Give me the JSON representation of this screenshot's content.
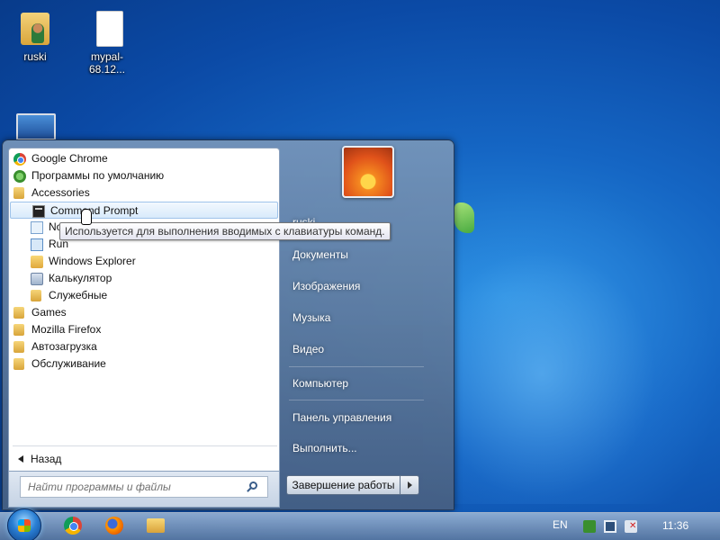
{
  "desktop": {
    "icons": [
      {
        "label": "ruski",
        "icon": "user-folder-icon"
      },
      {
        "label": "mypal-68.12...",
        "icon": "file-icon"
      },
      {
        "label": "",
        "icon": "computer-icon"
      }
    ]
  },
  "start_menu": {
    "programs": [
      {
        "label": "Google Chrome",
        "icon": "chrome-icon",
        "indent": false
      },
      {
        "label": "Программы по умолчанию",
        "icon": "default-programs-icon",
        "indent": false
      },
      {
        "label": "Accessories",
        "icon": "folder-icon",
        "indent": false
      },
      {
        "label": "Command Prompt",
        "icon": "command-prompt-icon",
        "indent": true,
        "highlighted": true
      },
      {
        "label": "No",
        "icon": "notepad-icon",
        "indent": true
      },
      {
        "label": "Run",
        "icon": "run-icon",
        "indent": true
      },
      {
        "label": "Windows Explorer",
        "icon": "explorer-icon",
        "indent": true
      },
      {
        "label": "Калькулятор",
        "icon": "calculator-icon",
        "indent": true
      },
      {
        "label": "Служебные",
        "icon": "folder-icon",
        "indent": true
      },
      {
        "label": "Games",
        "icon": "folder-icon",
        "indent": false
      },
      {
        "label": "Mozilla Firefox",
        "icon": "folder-icon",
        "indent": false
      },
      {
        "label": "Автозагрузка",
        "icon": "folder-icon",
        "indent": false
      },
      {
        "label": "Обслуживание",
        "icon": "folder-icon",
        "indent": false
      }
    ],
    "back_label": "Назад",
    "search_placeholder": "Найти программы и файлы",
    "tooltip": "Используется для выполнения вводимых с клавиатуры команд.",
    "right_items": {
      "user": "ruski",
      "documents": "Документы",
      "pictures": "Изображения",
      "music": "Музыка",
      "video": "Видео",
      "computer": "Компьютер",
      "control_panel": "Панель управления",
      "run": "Выполнить..."
    },
    "shutdown_label": "Завершение работы"
  },
  "taskbar": {
    "language": "EN",
    "time": "11:36",
    "pinned": [
      "chrome-icon",
      "firefox-icon",
      "explorer-icon"
    ]
  }
}
